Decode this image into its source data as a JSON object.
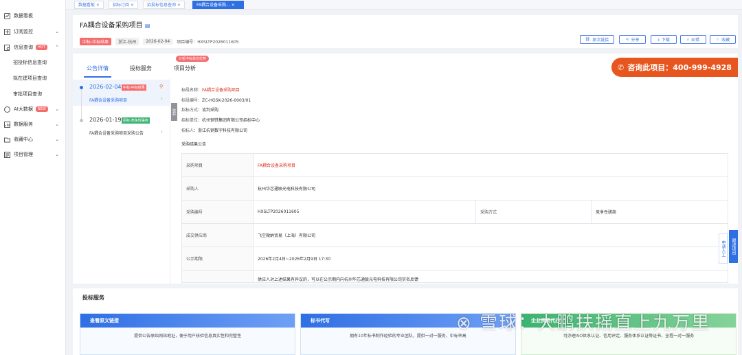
{
  "tabs": [
    {
      "label": "数据看板"
    },
    {
      "label": "招标订阅"
    },
    {
      "label": "招投标信息查询"
    },
    {
      "label": "FA耦合设备采购..."
    }
  ],
  "sidebar": {
    "items": [
      {
        "label": "数据看板",
        "icon": "dashboard-icon"
      },
      {
        "label": "订阅监控",
        "icon": "subscribe-icon"
      },
      {
        "label": "信息查询",
        "icon": "search-doc-icon",
        "badge": "HOT"
      },
      {
        "label": "招投标信息查询"
      },
      {
        "label": "拟在建项目查询"
      },
      {
        "label": "审批项目查询"
      },
      {
        "label": "AI大数据",
        "icon": "ai-icon",
        "badge": "NEW"
      },
      {
        "label": "数据服务",
        "icon": "data-service-icon"
      },
      {
        "label": "收藏中心",
        "icon": "favorite-folder-icon"
      },
      {
        "label": "项目管理",
        "icon": "project-manage-icon"
      }
    ]
  },
  "header": {
    "title": "FA耦合设备采购项目",
    "status_tag": "中标-中标结果",
    "region": "浙江-杭州",
    "date": "2026-02-04",
    "project_no": "项目编号：HXSLTP2026011605",
    "actions": [
      "原文链接",
      "分享",
      "下载",
      "纠错",
      "收藏"
    ]
  },
  "main": {
    "tabs": [
      "公告详情",
      "投标服务",
      "项目分析"
    ],
    "tab_badge": "分析中标单位优势",
    "phone": "咨询此项目：400-999-4928",
    "timeline": [
      {
        "date": "2026-02-04",
        "tag": "中标-中标结果",
        "title": "FA耦合设备采购项目"
      },
      {
        "date": "2026-01-19",
        "tag": "招标-竞争性磋商",
        "title": "FA耦合设备采购项目采购公告"
      }
    ],
    "collapse": "收起",
    "info": [
      {
        "k": "标段名称：",
        "v": "FA耦合设备采购项目"
      },
      {
        "k": "标段编号：",
        "v": "ZC-HGSK-2026-0003/01"
      },
      {
        "k": "招标方式：",
        "v": "谈判采购"
      },
      {
        "k": "招标单位：",
        "v": "杭州钢铁集团有限公司招标中心"
      },
      {
        "k": "招标人：",
        "v": "浙江杭钢数字科技有限公司"
      }
    ],
    "section_title": "采购结果公告",
    "table": {
      "r0": {
        "l": "采购项目",
        "v": "FA耦合设备采购项目"
      },
      "r1": {
        "l": "采购人",
        "v": "杭州华芯通联光电科技有限公司"
      },
      "r2": {
        "l": "采购编号",
        "v": "HXSLTP2026011605",
        "l2": "采购方式",
        "v2": "竞争性磋商"
      },
      "r3": {
        "l": "成交供应商",
        "v": "飞空微纳贸易（上海）有限公司"
      },
      "r4": {
        "l": "公示期限",
        "v": "2026年2月4日~2026年2月9日 17:30"
      },
      "r5": {
        "v": "供应人对上述结果有异议的，可以在公示期内向杭州华芯通联光电科技有限公司实名反馈"
      }
    }
  },
  "services": {
    "title": "投标服务",
    "cards": [
      {
        "title": "查看原文链接",
        "desc": "提供公告原始网站地址，便于用户核验信息真实性和完整性"
      },
      {
        "title": "标书代写",
        "desc": "拥有10年标书制作经验的专业团队，提供一对一服务，中标率高"
      },
      {
        "title": "企业资质代办",
        "desc": "可办理ISO体系认证、信用评定、服务体系认证等证书，全程一对一服务"
      }
    ]
  },
  "floats": {
    "apply": "申请人工",
    "follow": "跟进项目"
  },
  "watermark": "雪球：大鹏扶摇直上九万里"
}
